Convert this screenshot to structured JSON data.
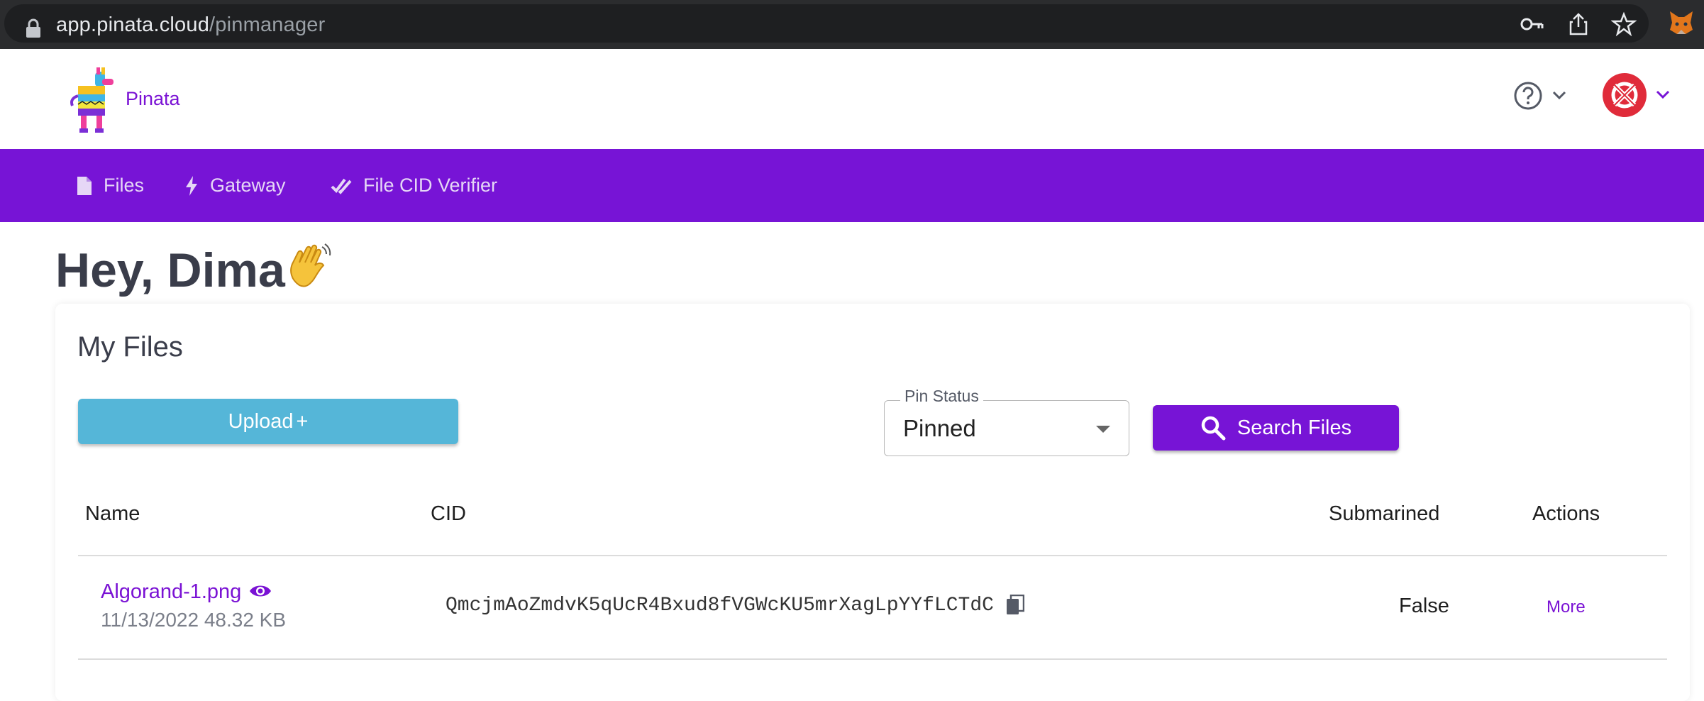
{
  "browser": {
    "url_host": "app.pinata.cloud",
    "url_path": "/pinmanager"
  },
  "header": {
    "brand": "Pinata"
  },
  "nav": {
    "items": [
      {
        "label": "Files",
        "icon": "file-icon"
      },
      {
        "label": "Gateway",
        "icon": "bolt-icon"
      },
      {
        "label": "File CID Verifier",
        "icon": "double-check-icon"
      }
    ]
  },
  "greeting": "Hey, Dima",
  "files_card": {
    "title": "My Files",
    "upload_label": "Upload",
    "upload_suffix": "+",
    "pin_status_label": "Pin Status",
    "pin_status_value": "Pinned",
    "search_label": "Search Files",
    "columns": [
      "Name",
      "CID",
      "Submarined",
      "Actions"
    ],
    "rows": [
      {
        "name": "Algorand-1.png",
        "meta": "11/13/2022 48.32 KB",
        "cid": "QmcjmAoZmdvK5qUcR4Bxud8fVGWcKU5mrXagLpYYfLCTdC",
        "submarined": "False",
        "action": "More"
      }
    ]
  },
  "colors": {
    "brand_purple": "#7714d6",
    "upload_blue": "#55b6d8",
    "browser_bar": "#2b2c2e"
  }
}
